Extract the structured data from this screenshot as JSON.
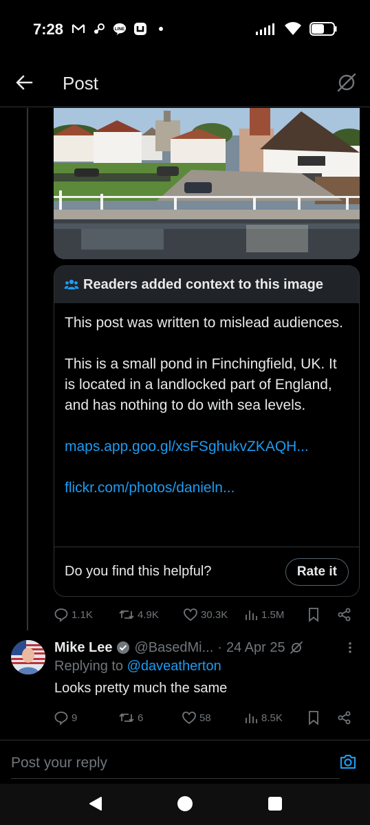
{
  "status_bar": {
    "time": "7:28",
    "icons_left": [
      "gmail-icon",
      "steam-icon",
      "line-icon",
      "app-icon",
      "dot-icon"
    ],
    "icons_right": [
      "signal-icon",
      "wifi-icon",
      "battery-icon"
    ]
  },
  "header": {
    "title": "Post",
    "back_icon": "arrow-left-icon",
    "grok_icon": "grok-icon"
  },
  "image": {
    "description_icon": "photo"
  },
  "community_note": {
    "title": "Readers added context to this image",
    "paragraph1": "This post was written to mislead audiences.",
    "paragraph2": "This is a small pond in Finchingfield, UK. It is located in a landlocked part of England, and has nothing to do with sea levels.",
    "link1": "maps.app.goo.gl/xsFSghukvZKAQH...",
    "link2": "flickr.com/photos/danieln...",
    "helpful_question": "Do you find this helpful?",
    "rate_label": "Rate it"
  },
  "main_actions": {
    "replies": "1.1K",
    "reposts": "4.9K",
    "likes": "30.3K",
    "views": "1.5M"
  },
  "reply": {
    "name": "Mike Lee",
    "handle": "@BasedMi...",
    "separator": "·",
    "date": "24 Apr 25",
    "replying_prefix": "Replying to",
    "replying_to": "@daveatherton",
    "text": "Looks pretty much the same",
    "actions": {
      "replies": "9",
      "reposts": "6",
      "likes": "58",
      "views": "8.5K"
    }
  },
  "compose": {
    "placeholder": "Post your reply"
  },
  "colors": {
    "background": "#000000",
    "text": "#e7e9ea",
    "muted": "#71767b",
    "link": "#1d9bf0",
    "border": "#2f3336",
    "note_header": "#202327"
  }
}
